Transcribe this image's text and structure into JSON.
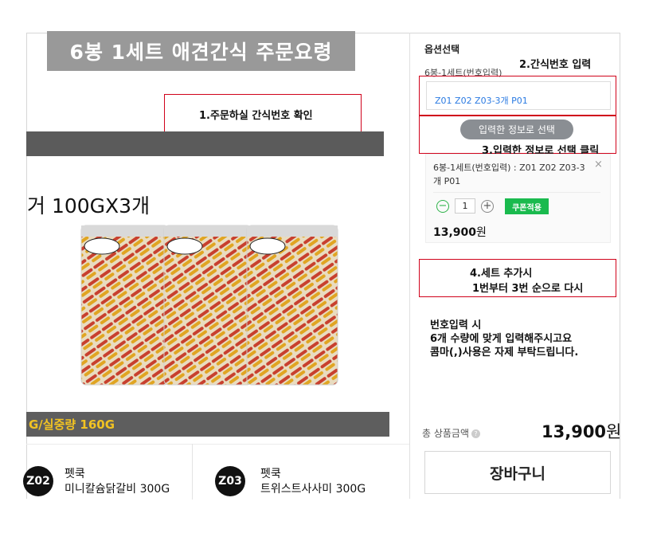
{
  "banner": {
    "title": "6봉 1세트 애견간식 주문요령"
  },
  "annotations": {
    "step1": "1.주문하실 간식번호 확인",
    "step2": "2.간식번호 입력",
    "step3": "3.입력한 정보로 선택 클릭",
    "step4_line1": "4.세트 추가시",
    "step4_line2": "1번부터 3번 순으로 다시"
  },
  "product": {
    "name": "거 100GX3개",
    "weight": "G/실중량 160G",
    "items": [
      {
        "code": "Z02",
        "brand": "펫쿡",
        "name": "미니칼슘닭갈비 300G"
      },
      {
        "code": "Z03",
        "brand": "펫쿡",
        "name": "트위스트사사미 300G"
      }
    ]
  },
  "options": {
    "title": "옵션선택",
    "subtitle": "6봉-1세트(번호입력)",
    "input_value": "Z01 Z02 Z03-3개 P01",
    "select_button": "입력한 정보로 선택",
    "selected": {
      "text": "6봉-1세트(번호입력) : Z01 Z02 Z03-3개 P01",
      "close": "×",
      "minus": "−",
      "quantity": "1",
      "plus": "+",
      "coupon": "쿠폰적용",
      "price": "13,900",
      "price_unit": "원"
    }
  },
  "note": {
    "line1": "번호입력 시",
    "line2": "6개 수량에 맞게 입력해주시고요",
    "line3": "콤마(,)사용은 자제 부탁드립니다."
  },
  "total": {
    "label": "총 상품금액",
    "help": "?",
    "price": "13,900",
    "unit": "원"
  },
  "cart": {
    "label": "장바구니"
  },
  "colors": {
    "annotation": "#d0021b",
    "coupon": "#1aba4e",
    "weight_text": "#f2c322",
    "input_text": "#2a7ae2"
  }
}
